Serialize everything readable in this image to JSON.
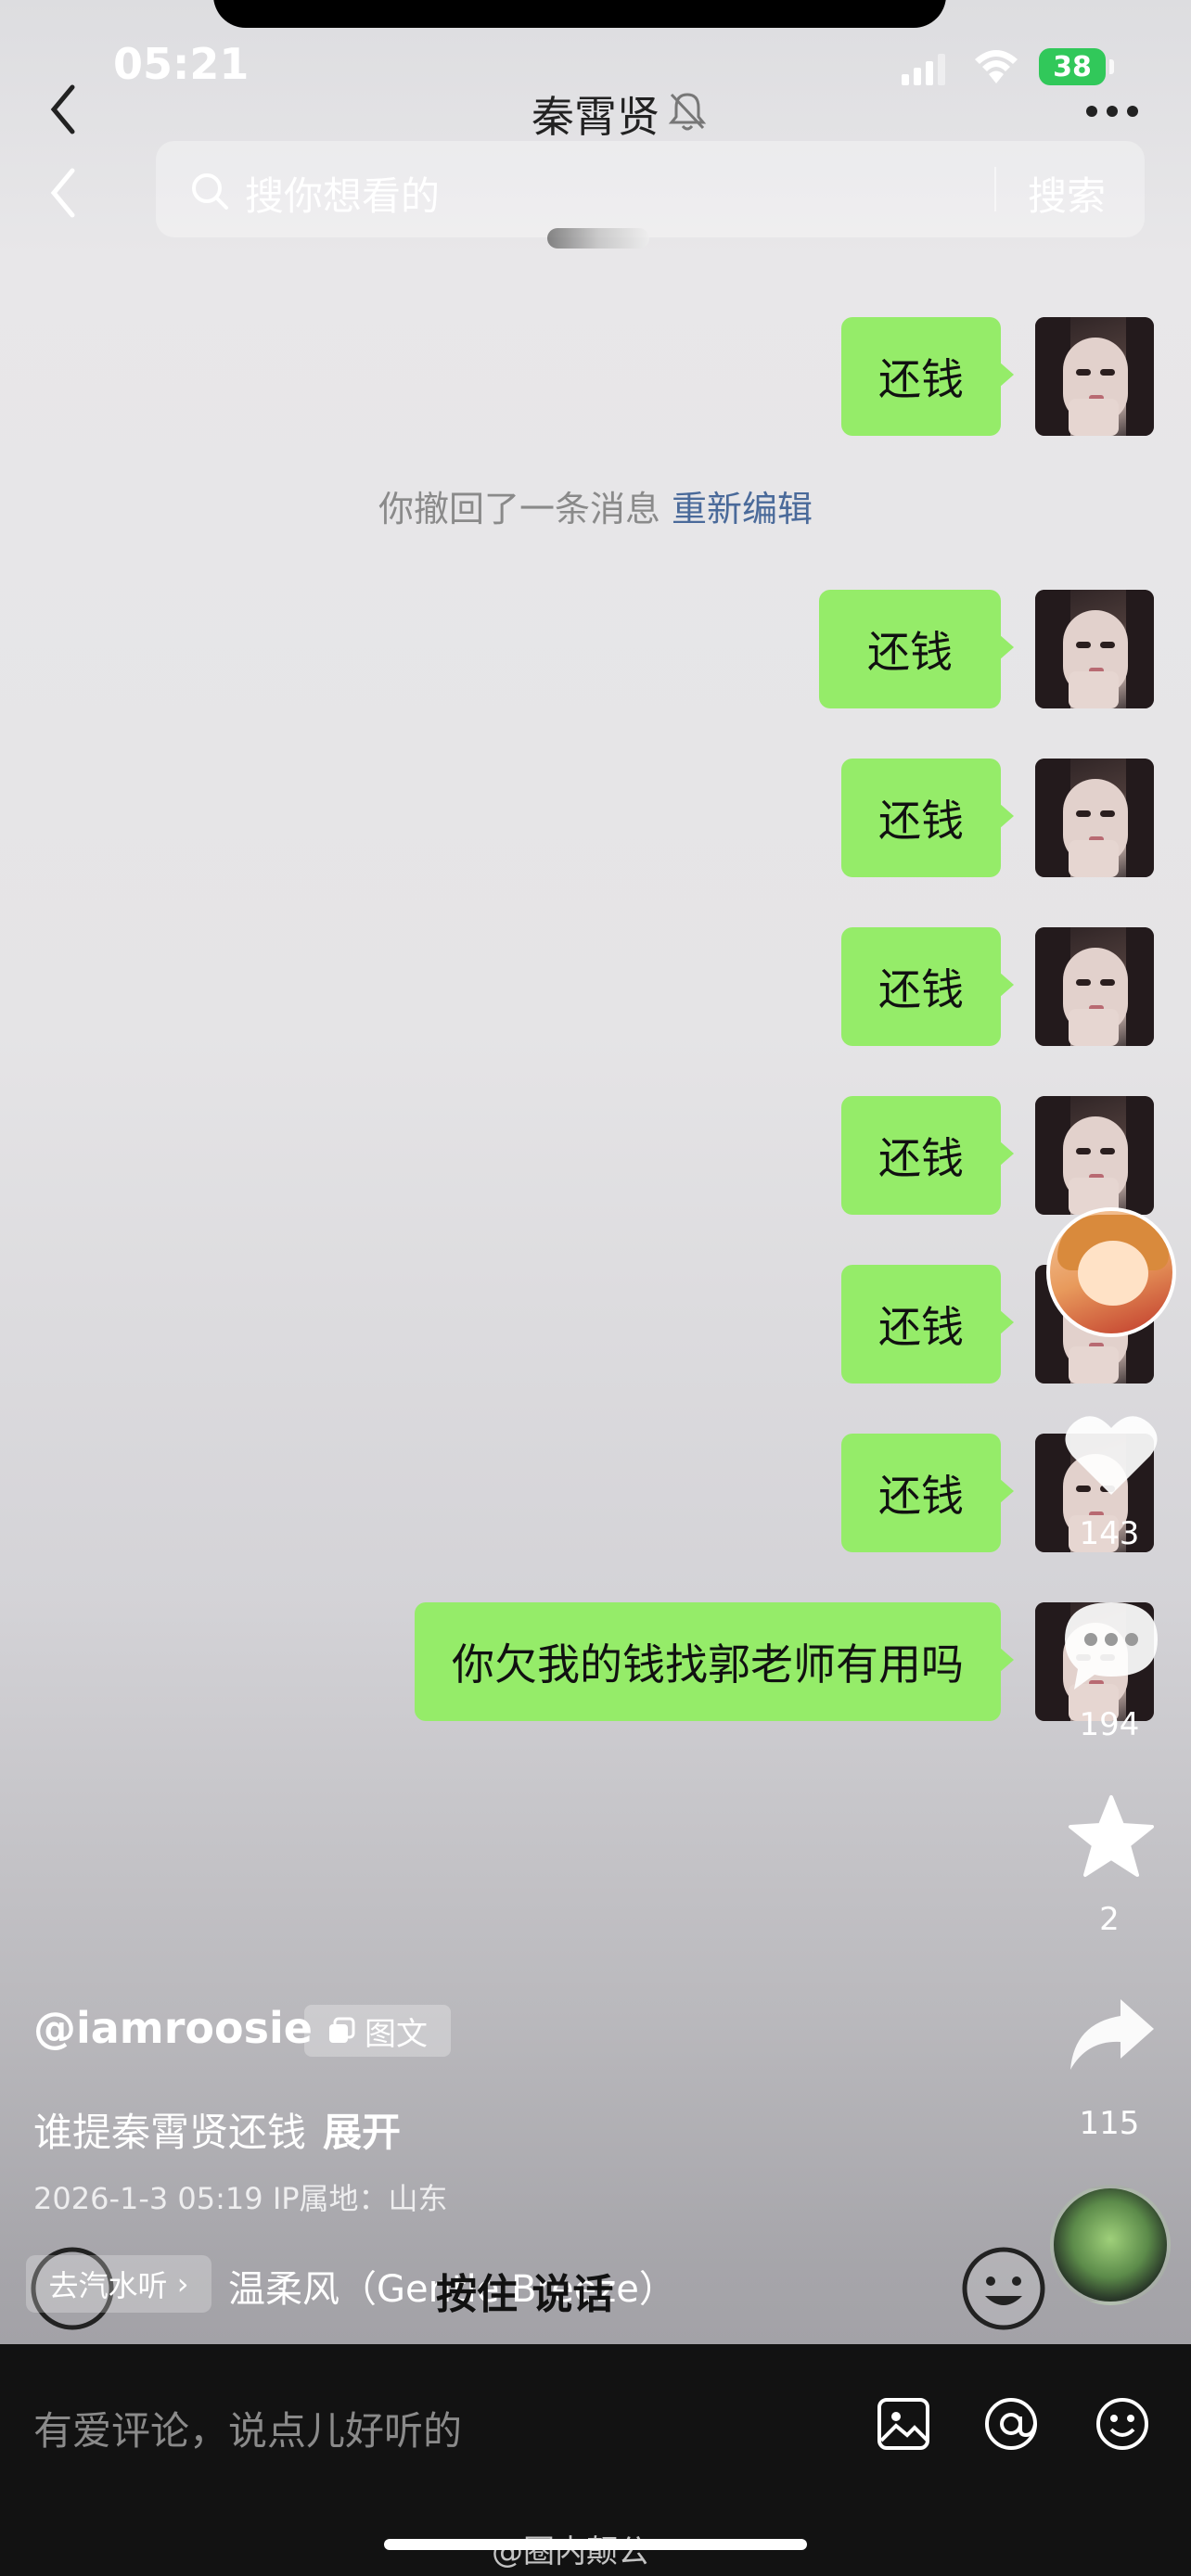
{
  "status": {
    "time": "05:21",
    "battery": "38"
  },
  "chat": {
    "title": "秦霄贤"
  },
  "search": {
    "placeholder": "搜你想看的",
    "button": "搜索"
  },
  "messages": [
    {
      "text": "还钱"
    },
    {
      "text": "还钱"
    },
    {
      "text": "还钱"
    },
    {
      "text": "还钱"
    },
    {
      "text": "还钱"
    },
    {
      "text": "还钱"
    },
    {
      "text": "还钱"
    },
    {
      "text": "你欠我的钱找郭老师有用吗"
    }
  ],
  "recall_notice": {
    "text": "你撤回了一条消息",
    "action": "重新编辑"
  },
  "rail": {
    "likes": "143",
    "comments": "194",
    "favorites": "2",
    "shares": "115"
  },
  "post": {
    "handle": "@iamroosie",
    "tag": "图文",
    "description": "谁提秦霄贤还钱",
    "expand": "展开",
    "meta": "2026-1-3 05:19  IP属地：山东"
  },
  "music": {
    "pill": "去汽水听",
    "title": "温柔风（Gentle Breeze）"
  },
  "input": {
    "hold_to_talk": "按住 说话"
  },
  "comment_bar": {
    "placeholder": "有爱评论，说点儿好听的"
  },
  "watermark": "@圈内颠公",
  "colors": {
    "bubble": "#95ec69",
    "battery": "#31c85a",
    "link": "#4a6a9a"
  }
}
